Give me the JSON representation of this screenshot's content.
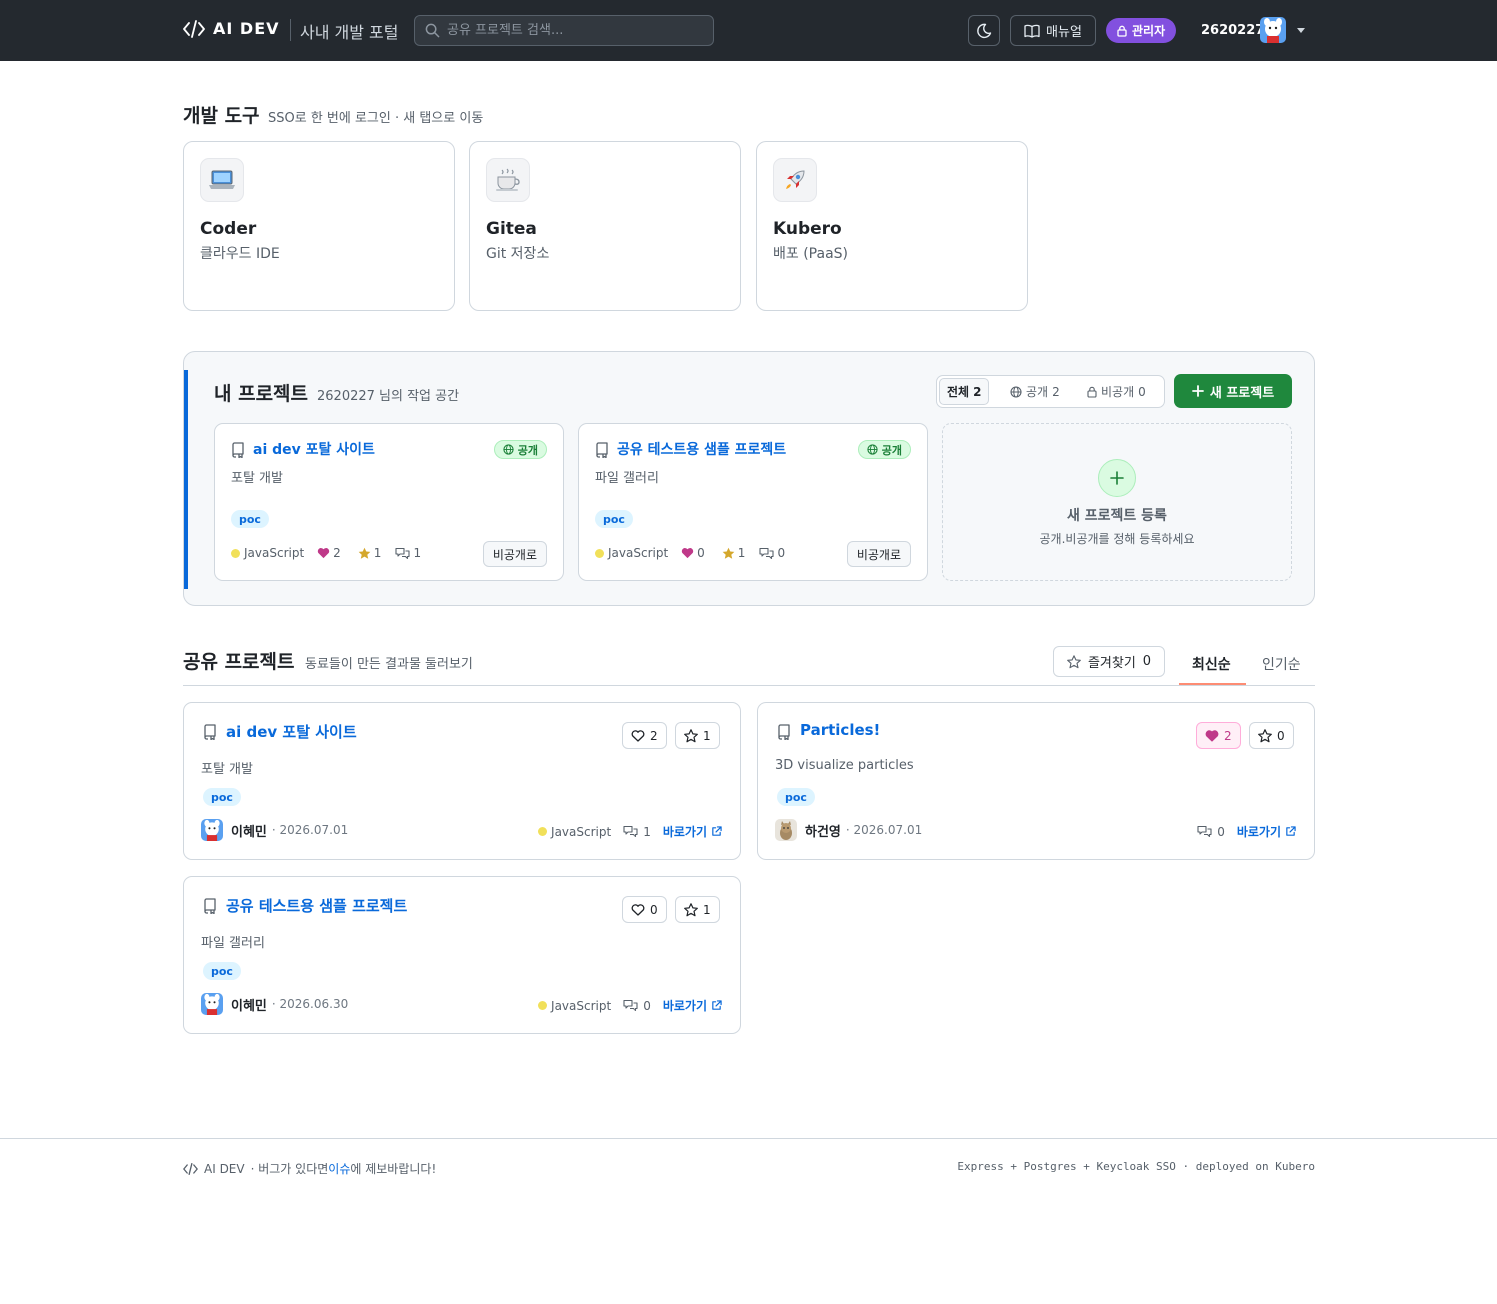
{
  "header": {
    "logo": "AI DEV",
    "subtitle": "사내 개발 포털",
    "search_placeholder": "공유 프로젝트 검색...",
    "manual_label": "매뉴얼",
    "admin_label": "관리자",
    "user_id": "2620227"
  },
  "tools": {
    "title": "개발 도구",
    "subtitle": "SSO로 한 번에 로그인 · 새 탭으로 이동",
    "items": [
      {
        "name": "Coder",
        "desc": "클라우드 IDE",
        "icon": "laptop-icon"
      },
      {
        "name": "Gitea",
        "desc": "Git 저장소",
        "icon": "tea-icon"
      },
      {
        "name": "Kubero",
        "desc": "배포 (PaaS)",
        "icon": "rocket-icon"
      }
    ]
  },
  "my_projects": {
    "title": "내 프로젝트",
    "subtitle": "2620227 님의 작업 공간",
    "filters": [
      {
        "label": "전체",
        "count": "2"
      },
      {
        "label": "공개",
        "count": "2"
      },
      {
        "label": "비공개",
        "count": "0"
      }
    ],
    "new_button": "새 프로젝트",
    "cards": [
      {
        "title": "ai dev 포탈 사이트",
        "badge": "공개",
        "desc": "포탈 개발",
        "tag": "poc",
        "lang": "JavaScript",
        "likes": "2",
        "stars": "1",
        "comments": "1",
        "action": "비공개로"
      },
      {
        "title": "공유 테스트용 샘플 프로젝트",
        "badge": "공개",
        "desc": "파일 갤러리",
        "tag": "poc",
        "lang": "JavaScript",
        "likes": "0",
        "stars": "1",
        "comments": "0",
        "action": "비공개로"
      }
    ],
    "new_card": {
      "title": "새 프로젝트 등록",
      "sub": "공개.비공개를 정해 등록하세요"
    }
  },
  "shared": {
    "title": "공유 프로젝트",
    "subtitle": "동료들이 만든 결과물 둘러보기",
    "favorites_label": "즐겨찾기",
    "favorites_count": "0",
    "sort_tabs": [
      "최신순",
      "인기순"
    ],
    "cards": [
      {
        "title": "ai dev 포탈 사이트",
        "desc": "포탈 개발",
        "tag": "poc",
        "likes": "2",
        "stars": "1",
        "author": "이혜민",
        "date": "· 2026.07.01",
        "lang": "JavaScript",
        "comments": "1",
        "link": "바로가기"
      },
      {
        "title": "Particles!",
        "desc": "3D visualize particles",
        "tag": "poc",
        "likes": "2",
        "stars": "0",
        "author": "하건영",
        "date": "· 2026.07.01",
        "lang": "",
        "comments": "0",
        "link": "바로가기"
      },
      {
        "title": "공유 테스트용 샘플 프로젝트",
        "desc": "파일 갤러리",
        "tag": "poc",
        "likes": "0",
        "stars": "1",
        "author": "이혜민",
        "date": "· 2026.06.30",
        "lang": "JavaScript",
        "comments": "0",
        "link": "바로가기"
      }
    ]
  },
  "footer": {
    "brand": "AI DEV",
    "text_pre": "· 버그가 있다면",
    "link": "이슈",
    "text_post": "에 제보바랍니다!",
    "right": "Express + Postgres + Keycloak SSO  ·  deployed on Kubero"
  },
  "colors": {
    "header_bg": "#24292f",
    "accent": "#0969da",
    "primary_button": "#1f883d",
    "admin_badge": "#8250df",
    "like": "#bf3989",
    "star": "#d4a72c",
    "lang_js": "#f1e05a"
  }
}
